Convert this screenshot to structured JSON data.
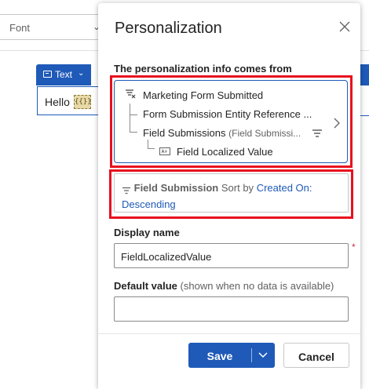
{
  "editor": {
    "font_select": "Font",
    "text_button": "Text",
    "text_content": "Hello",
    "token_glyph": "{{}}"
  },
  "panel": {
    "title": "Personalization",
    "source_label": "The personalization info comes from",
    "source": {
      "trigger": "Marketing Form Submitted",
      "entity_ref": "Form Submission Entity Reference ...",
      "relation": "Field Submissions",
      "relation_hint": "(Field Submissi...",
      "attribute": "Field Localized Value"
    },
    "sort": {
      "entity": "Field Submission",
      "sort_by_text": "Sort by",
      "field": "Created On:",
      "direction": "Descending"
    },
    "display_name": {
      "label": "Display name",
      "value": "FieldLocalizedValue",
      "required_mark": "*"
    },
    "default_value": {
      "label": "Default value",
      "hint": "(shown when no data is available)",
      "value": ""
    },
    "buttons": {
      "save": "Save",
      "cancel": "Cancel"
    }
  },
  "colors": {
    "accent": "#1f5ab8",
    "highlight_border": "#e8101e",
    "required": "#c4314b"
  },
  "icons": [
    "filter-trigger-icon",
    "filter-icon",
    "text-field-icon",
    "chevron-right-icon",
    "close-icon",
    "chevron-down-icon",
    "text-icon"
  ]
}
